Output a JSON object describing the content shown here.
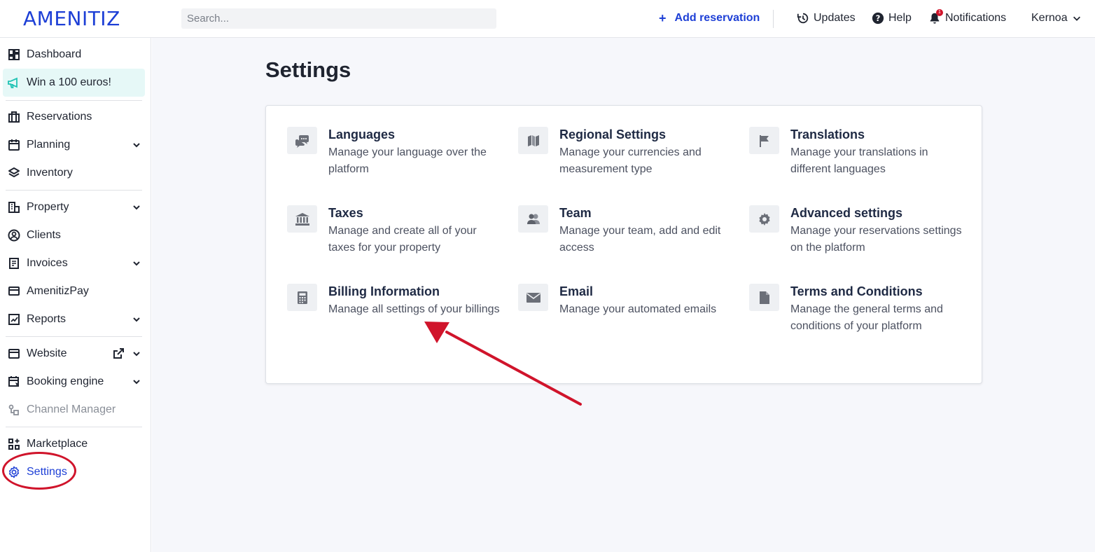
{
  "header": {
    "logo": "AMENITIZ",
    "search_placeholder": "Search...",
    "add_reservation": "Add reservation",
    "updates": "Updates",
    "help": "Help",
    "notifications": "Notifications",
    "notifications_count": "1",
    "user_name": "Kernoa"
  },
  "sidebar": {
    "dashboard": "Dashboard",
    "promo": "Win a 100 euros!",
    "reservations": "Reservations",
    "planning": "Planning",
    "inventory": "Inventory",
    "property": "Property",
    "clients": "Clients",
    "invoices": "Invoices",
    "amenitizpay": "AmenitizPay",
    "reports": "Reports",
    "website": "Website",
    "booking_engine": "Booking engine",
    "channel_manager": "Channel Manager",
    "marketplace": "Marketplace",
    "settings": "Settings"
  },
  "main": {
    "title": "Settings",
    "tiles": [
      {
        "title": "Languages",
        "description": "Manage your language over the platform",
        "icon": "chat-bubbles-icon"
      },
      {
        "title": "Regional Settings",
        "description": "Manage your currencies and measurement type",
        "icon": "map-icon"
      },
      {
        "title": "Translations",
        "description": "Manage your translations in different languages",
        "icon": "flag-icon"
      },
      {
        "title": "Taxes",
        "description": "Manage and create all of your taxes for your property",
        "icon": "bank-icon"
      },
      {
        "title": "Team",
        "description": "Manage your team, add and edit access",
        "icon": "users-icon"
      },
      {
        "title": "Advanced settings",
        "description": "Manage your reservations settings on the platform",
        "icon": "gear-icon"
      },
      {
        "title": "Billing Information",
        "description": "Manage all settings of your billings",
        "icon": "calculator-icon"
      },
      {
        "title": "Email",
        "description": "Manage your automated emails",
        "icon": "envelope-icon"
      },
      {
        "title": "Terms and Conditions",
        "description": "Manage the general terms and conditions of your platform",
        "icon": "document-icon"
      }
    ]
  },
  "colors": {
    "brand": "#1d3fd6",
    "annotation": "#d0142b",
    "promo_bg": "#e6f8f7",
    "page_bg": "#f6f7fb",
    "icon_gray": "#6b6f78"
  }
}
